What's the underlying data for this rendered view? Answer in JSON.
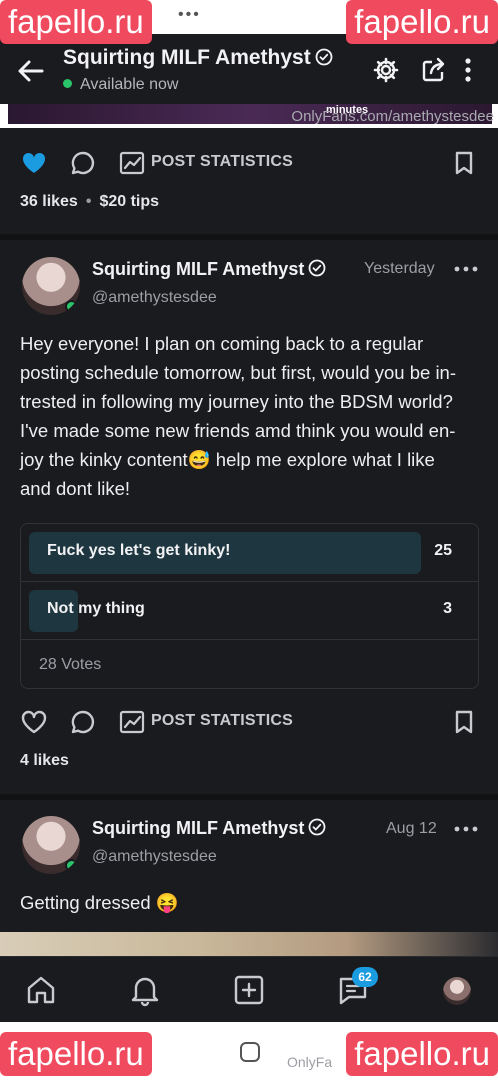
{
  "watermarks": [
    "fapello.ru",
    "fapello.ru",
    "fapello.ru",
    "fapello.ru"
  ],
  "status_bar": {
    "dots": "•••"
  },
  "header": {
    "title": "Squirting MILF Amethyst",
    "status": "Available now"
  },
  "top_media": {
    "caption_fragment": "minutes",
    "url": "OnlyFans.com/amethystesdee"
  },
  "previous_post": {
    "post_statistics_label": "POST STATISTICS",
    "likes": "36 likes",
    "tips": "$20 tips"
  },
  "post1": {
    "author": "Squirting MILF Amethyst",
    "handle": "@amethystesdee",
    "time": "Yesterday",
    "text_lines": [
      "Hey everyone! I plan on coming back to a regular",
      "posting schedule tomorrow, but first, would you be in-",
      "trested in following my journey into the BDSM world?",
      "I've made some new friends amd think you would en-",
      "joy the kinky content😅 help me explore what I like",
      "and dont like!"
    ],
    "poll": {
      "options": [
        {
          "label": "Fuck yes let's get kinky!",
          "votes": "25",
          "fraction": 0.89
        },
        {
          "label": "Not my thing",
          "votes": "3",
          "fraction": 0.11
        }
      ],
      "total": "28 Votes"
    },
    "post_statistics_label": "POST STATISTICS",
    "likes": "4 likes"
  },
  "post2": {
    "author": "Squirting MILF Amethyst",
    "handle": "@amethystesdee",
    "time": "Aug 12",
    "text": "Getting dressed 😝"
  },
  "bottom_nav": {
    "messages_badge": "62"
  },
  "system_bar": {
    "url_fragment": "OnlyFa"
  },
  "colors": {
    "background": "#1a1b1e",
    "accent_blue": "#1b9be0",
    "online_green": "#2bc46a",
    "poll_bar": "#1e3640",
    "watermark_red": "#f04a5e"
  }
}
